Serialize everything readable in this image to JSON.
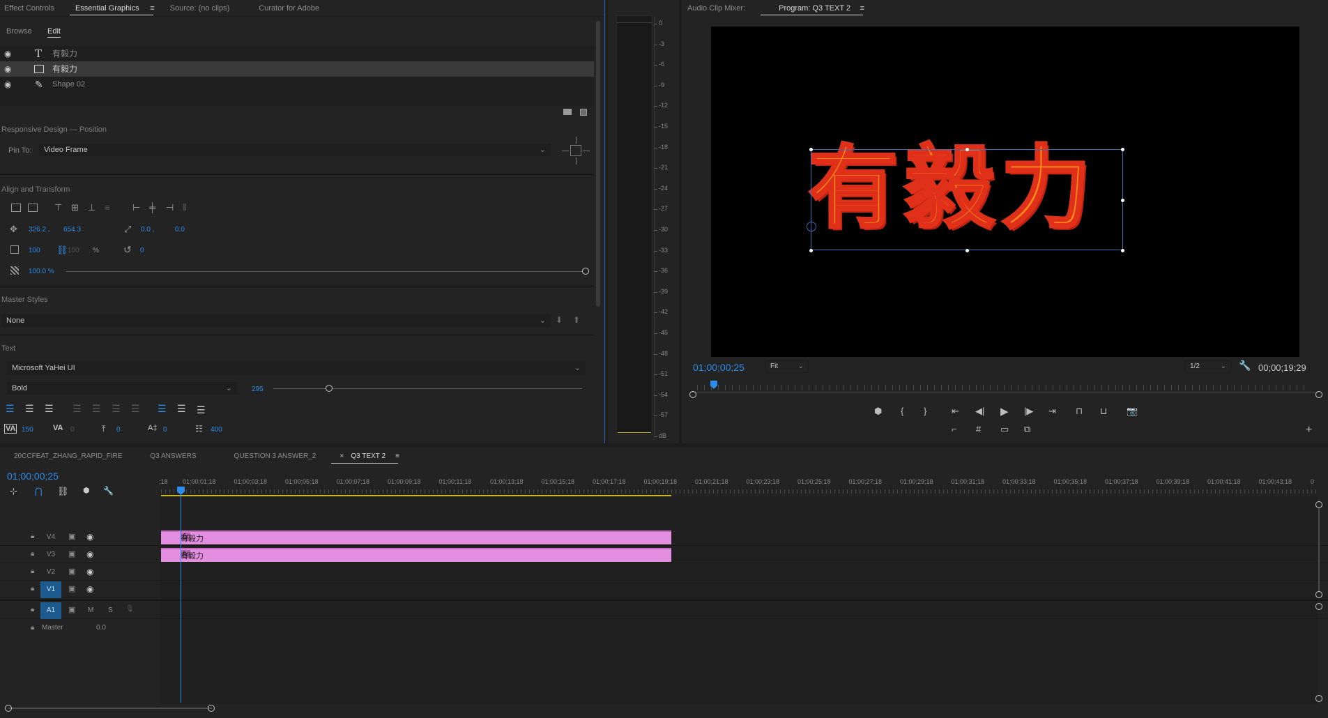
{
  "left_panel": {
    "tabs": [
      "Effect Controls",
      "Essential Graphics",
      "Source: (no clips)",
      "Curator for Adobe"
    ],
    "subtabs": [
      "Browse",
      "Edit"
    ],
    "layers": [
      {
        "icon": "text-icon",
        "label": "有毅力"
      },
      {
        "icon": "clip-icon",
        "label": "有毅力"
      },
      {
        "icon": "pen-icon",
        "label": "Shape 02"
      }
    ],
    "responsive_title": "Responsive Design — Position",
    "pin_to_label": "Pin To:",
    "pin_to_value": "Video Frame",
    "align_title": "Align and Transform",
    "position_x": "326.2 ,",
    "position_y": "654.3",
    "anchor_x": "0.0 ,",
    "anchor_y": "0.0",
    "scale": "100",
    "scale_linked": "100",
    "percent": "%",
    "rotation": "0",
    "opacity": "100.0 %",
    "master_styles_title": "Master Styles",
    "master_styles_value": "None",
    "text_title": "Text",
    "font_family": "Microsoft YaHei UI",
    "font_style": "Bold",
    "font_size": "295",
    "tracking": "150",
    "kerning": "0",
    "baseline": "0",
    "tsume": "0",
    "leading": "400"
  },
  "audio_meter": {
    "scale": [
      "0",
      "-3",
      "-6",
      "-9",
      "-12",
      "-15",
      "-18",
      "-21",
      "-24",
      "-27",
      "-30",
      "-33",
      "-36",
      "-39",
      "-42",
      "-45",
      "-48",
      "-51",
      "-54",
      "-57",
      "dB"
    ]
  },
  "program_monitor": {
    "tabs": [
      "Audio Clip Mixer:",
      "Program: Q3 TEXT 2"
    ],
    "video_text": "有毅力",
    "timecode_current": "01;00;00;25",
    "fit": "Fit",
    "resolution": "1/2",
    "timecode_duration": "00;00;19;29"
  },
  "timeline": {
    "tabs": [
      "20CCFEAT_ZHANG_RAPID_FIRE",
      "Q3 ANSWERS",
      "QUESTION 3 ANSWER_2",
      "Q3 TEXT 2"
    ],
    "close_glyph": "×",
    "timecode": "01;00;00;25",
    "ruler": [
      "01;00;01;18",
      "01;00;03;18",
      "01;00;05;18",
      "01;00;07;18",
      "01;00;09;18",
      "01;00;11;18",
      "01;00;13;18",
      "01;00;15;18",
      "01;00;17;18",
      "01;00;19;18",
      "01;00;21;18",
      "01;00;23;18",
      "01;00;25;18",
      "01;00;27;18",
      "01;00;29;18",
      "01;00;31;18",
      "01;00;33;18",
      "01;00;35;18",
      "01;00;37;18",
      "01;00;39;18",
      "01;00;41;18",
      "01;00;43;18"
    ],
    "ruler_start": ";18",
    "ruler_end": "0",
    "tracks": [
      "V4",
      "V3",
      "V2",
      "V1",
      "A1"
    ],
    "master_label": "Master",
    "master_value": "0.0",
    "clips": [
      {
        "track": "V4",
        "label": "有毅力"
      },
      {
        "track": "V3",
        "label": "有毅力"
      }
    ],
    "m_label": "M",
    "s_label": "S"
  }
}
